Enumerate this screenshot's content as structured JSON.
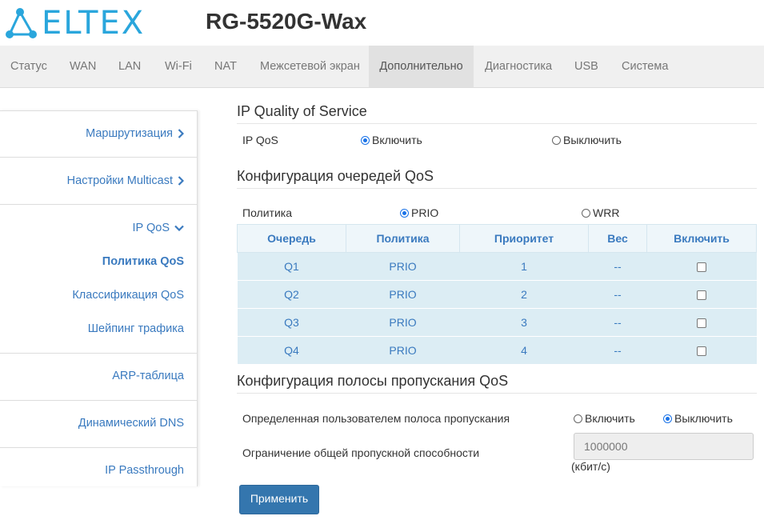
{
  "brand": {
    "logo_text": "ELTEX",
    "model": "RG-5520G-Wax",
    "accent": "#2aa6dc"
  },
  "nav": {
    "items": [
      {
        "label": "Статус"
      },
      {
        "label": "WAN"
      },
      {
        "label": "LAN"
      },
      {
        "label": "Wi-Fi"
      },
      {
        "label": "NAT"
      },
      {
        "label": "Межсетевой экран"
      },
      {
        "label": "Дополнительно"
      },
      {
        "label": "Диагностика"
      },
      {
        "label": "USB"
      },
      {
        "label": "Система"
      }
    ],
    "active": "Дополнительно"
  },
  "sidebar": {
    "items": [
      {
        "label": "Маршрутизация",
        "icon": "chevron-right-icon"
      },
      {
        "label": "Настройки Multicast",
        "icon": "chevron-right-icon"
      },
      {
        "label": "IP QoS",
        "icon": "chevron-down-icon"
      },
      {
        "label": "Политика QoS"
      },
      {
        "label": "Классификация QoS"
      },
      {
        "label": "Шейпинг трафика"
      },
      {
        "label": "ARP-таблица"
      },
      {
        "label": "Динамический DNS"
      },
      {
        "label": "IP Passthrough"
      }
    ],
    "active": "Политика QoS"
  },
  "qos": {
    "title": "IP Quality of Service",
    "label": "IP QoS",
    "enable": "Включить",
    "disable": "Выключить",
    "selected": "enable"
  },
  "queues": {
    "title": "Конфигурация очередей QoS",
    "policy_label": "Политика",
    "prio": "PRIO",
    "wrr": "WRR",
    "selected": "prio",
    "columns": [
      "Очередь",
      "Политика",
      "Приоритет",
      "Вес",
      "Включить"
    ],
    "rows": [
      {
        "queue": "Q1",
        "policy": "PRIO",
        "priority": "1",
        "weight": "--",
        "enabled": false
      },
      {
        "queue": "Q2",
        "policy": "PRIO",
        "priority": "2",
        "weight": "--",
        "enabled": false
      },
      {
        "queue": "Q3",
        "policy": "PRIO",
        "priority": "3",
        "weight": "--",
        "enabled": false
      },
      {
        "queue": "Q4",
        "policy": "PRIO",
        "priority": "4",
        "weight": "--",
        "enabled": false
      }
    ]
  },
  "bandwidth": {
    "title": "Конфигурация полосы пропускания QoS",
    "user_label": "Определенная пользователем полоса пропускания",
    "enable": "Включить",
    "disable": "Выключить",
    "selected": "disable",
    "limit_label": "Ограничение общей пропускной способности",
    "limit_value": "1000000",
    "unit": "(кбит/с)"
  },
  "apply_label": "Применить"
}
